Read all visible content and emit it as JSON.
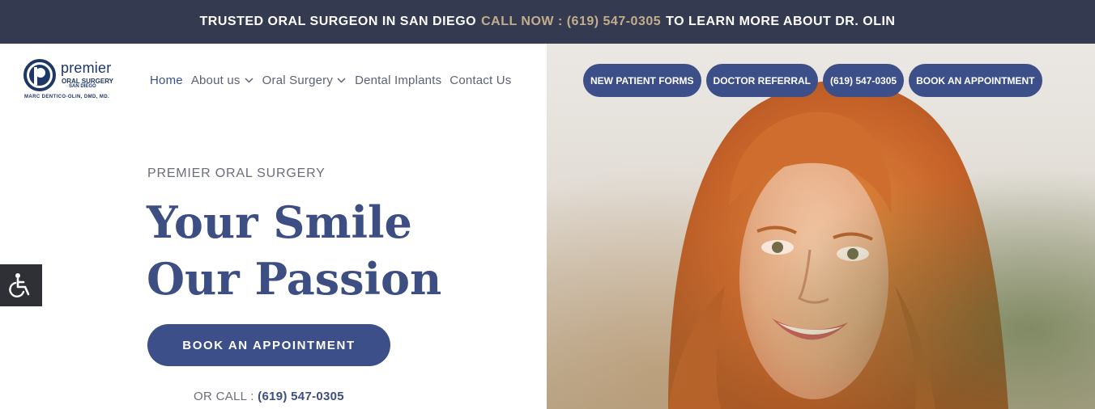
{
  "topbar": {
    "part1": "TRUSTED ORAL SURGEON IN SAN DIEGO",
    "call_label": "CALL NOW : (619) 547-0305",
    "part2": "TO LEARN MORE ABOUT DR. OLIN"
  },
  "logo": {
    "name": "premier",
    "line1": "ORAL SURGERY",
    "line2": "SAN DIEGO",
    "tagline": "MARC DENTICO-OLIN, DMD, MD."
  },
  "nav": {
    "items": [
      {
        "label": "Home",
        "dropdown": false
      },
      {
        "label": "About us",
        "dropdown": true
      },
      {
        "label": "Oral Surgery",
        "dropdown": true
      },
      {
        "label": "Dental Implants",
        "dropdown": false
      },
      {
        "label": "Contact Us",
        "dropdown": false
      }
    ]
  },
  "header_buttons": [
    {
      "label": "NEW PATIENT FORMS"
    },
    {
      "label": "DOCTOR REFERRAL"
    },
    {
      "label": "(619) 547-0305"
    },
    {
      "label": "BOOK AN APPOINTMENT"
    }
  ],
  "hero": {
    "kicker": "PREMIER ORAL SURGERY",
    "headline_line1": "Your Smile",
    "headline_line2": "Our Passion",
    "cta_label": "BOOK AN APPOINTMENT",
    "or_call_label": "OR CALL :",
    "phone": "(619) 547-0305"
  },
  "icons": {
    "accessibility": "wheelchair-icon",
    "chevron": "chevron-down-icon"
  },
  "colors": {
    "brand": "#3c4f88",
    "topbar_bg": "#343a50",
    "accent_gold": "#c2ad8c"
  }
}
